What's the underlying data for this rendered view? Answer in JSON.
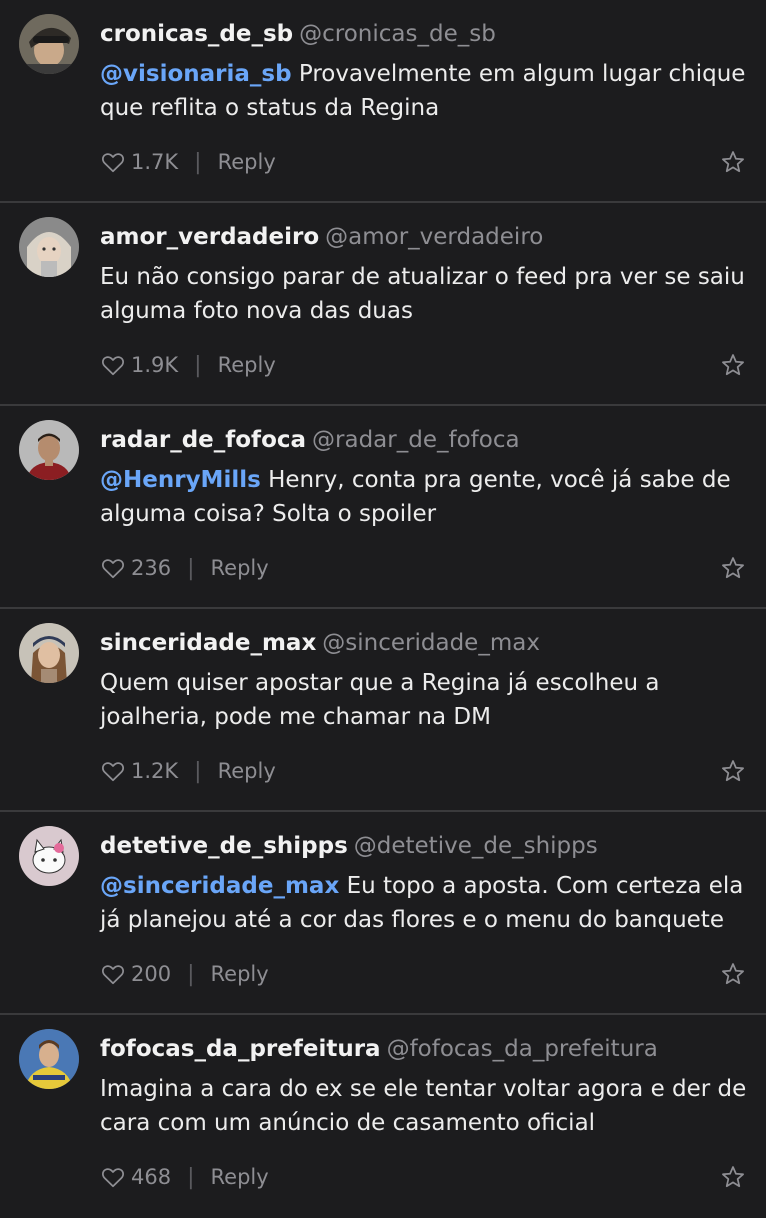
{
  "comments": [
    {
      "display_name": "cronicas_de_sb",
      "handle": "@cronicas_de_sb",
      "mention": "@visionaria_sb",
      "text": " Provavelmente em algum lugar chique que reflita o status da Regina",
      "likes": "1.7K",
      "reply_label": "Reply",
      "avatar_icon": "profile-photo"
    },
    {
      "display_name": "amor_verdadeiro",
      "handle": "@amor_verdadeiro",
      "mention": "",
      "text": "Eu não consigo parar de atualizar o feed pra ver se saiu alguma foto nova das duas",
      "likes": "1.9K",
      "reply_label": "Reply",
      "avatar_icon": "profile-photo"
    },
    {
      "display_name": "radar_de_fofoca",
      "handle": "@radar_de_fofoca",
      "mention": "@HenryMills",
      "text": " Henry, conta pra gente, você já sabe de alguma coisa? Solta o spoiler",
      "likes": "236",
      "reply_label": "Reply",
      "avatar_icon": "profile-photo"
    },
    {
      "display_name": "sinceridade_max",
      "handle": "@sinceridade_max",
      "mention": "",
      "text": "Quem quiser apostar que a Regina já escolheu a joalheria, pode me chamar na DM",
      "likes": "1.2K",
      "reply_label": "Reply",
      "avatar_icon": "profile-photo"
    },
    {
      "display_name": "detetive_de_shipps",
      "handle": "@detetive_de_shipps",
      "mention": "@sinceridade_max",
      "text": " Eu topo a aposta. Com certeza ela já planejou até a cor das flores e o menu do banquete",
      "likes": "200",
      "reply_label": "Reply",
      "avatar_icon": "profile-photo"
    },
    {
      "display_name": "fofocas_da_prefeitura",
      "handle": "@fofocas_da_prefeitura",
      "mention": "",
      "text": "Imagina a cara do ex se ele tentar voltar agora e der de cara com um anúncio de casamento oficial",
      "likes": "468",
      "reply_label": "Reply",
      "avatar_icon": "profile-photo"
    }
  ],
  "colors": {
    "background": "#1c1c1e",
    "divider": "#3a3a3c",
    "mention": "#6aa6f8",
    "muted": "#8e8e93",
    "text": "#ececec"
  }
}
